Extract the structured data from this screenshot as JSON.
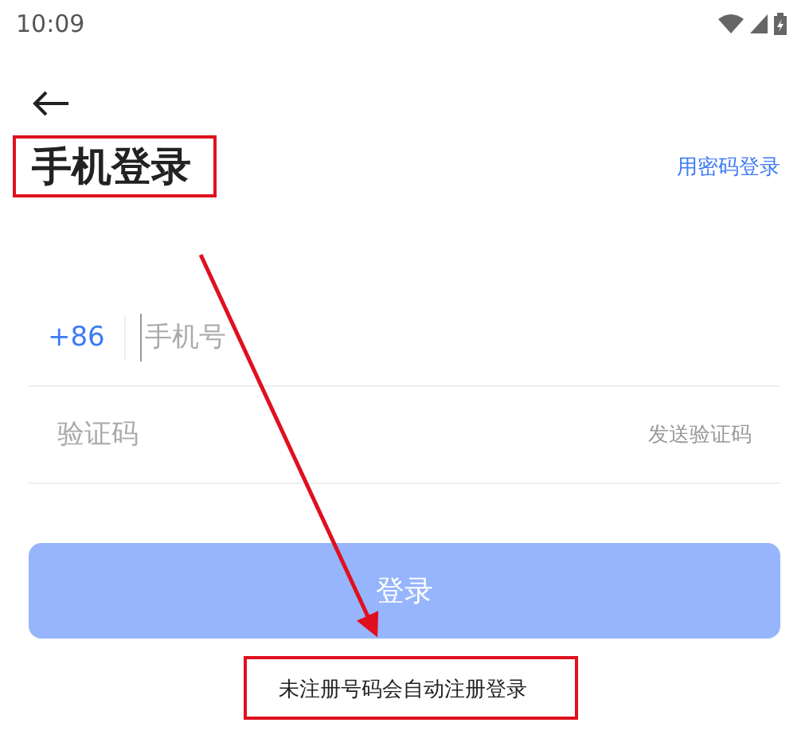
{
  "status_bar": {
    "time": "10:09"
  },
  "header": {
    "title": "手机登录",
    "title_highlighted": true,
    "switch_link": "用密码登录"
  },
  "phone_field": {
    "country_code": "+86",
    "placeholder": "手机号"
  },
  "code_field": {
    "placeholder": "验证码",
    "send_button": "发送验证码"
  },
  "login_button": {
    "label": "登录",
    "disabled": true
  },
  "notice": {
    "text": "未注册号码会自动注册登录",
    "highlighted": true
  },
  "arrow_annotation": true
}
